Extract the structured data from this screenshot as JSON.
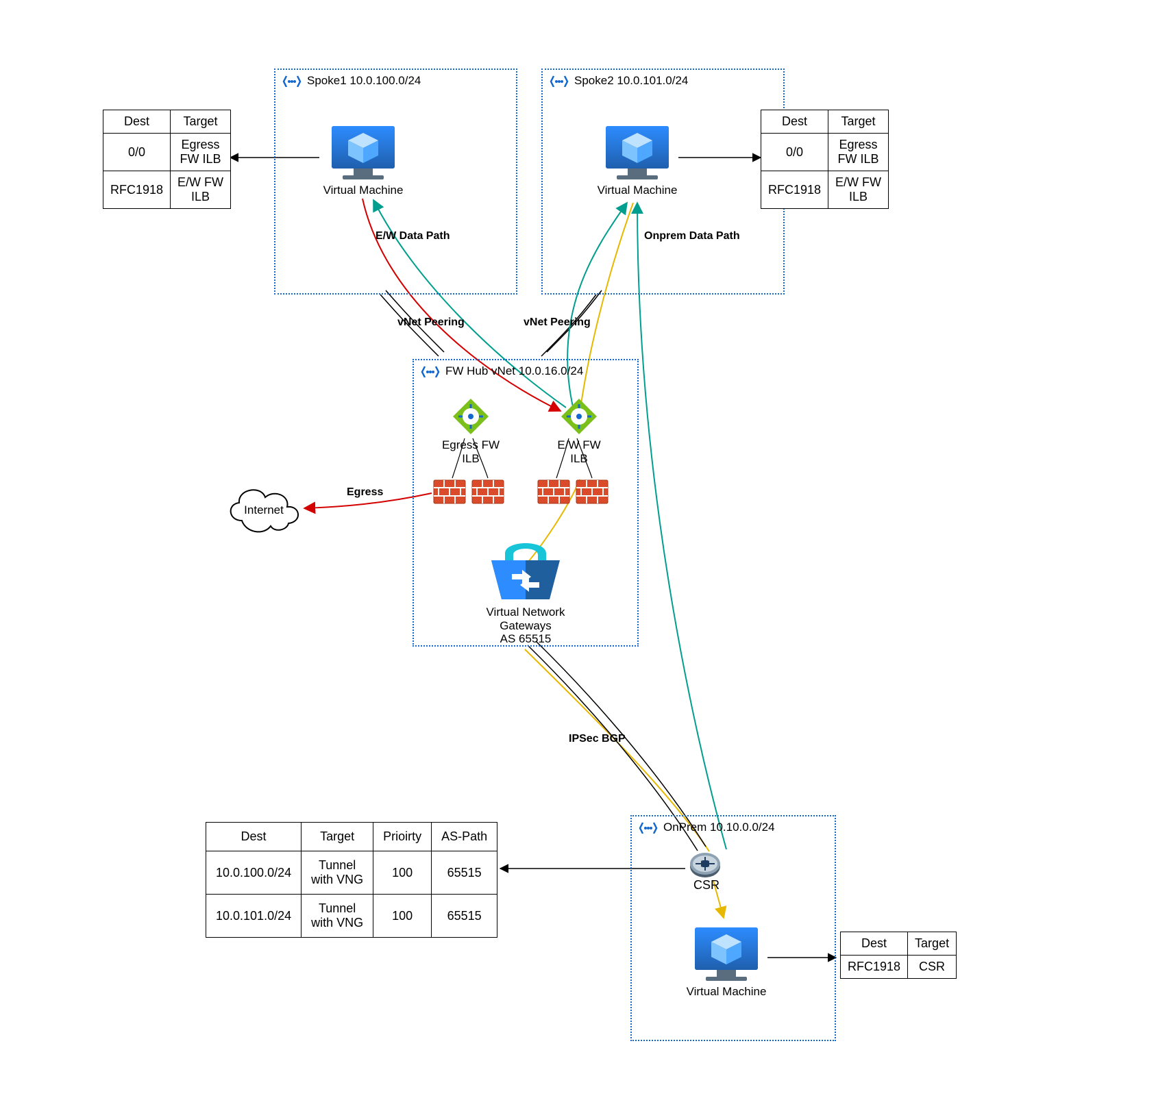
{
  "vnets": {
    "spoke1": {
      "title": "Spoke1 10.0.100.0/24"
    },
    "spoke2": {
      "title": "Spoke2 10.0.101.0/24"
    },
    "hub": {
      "title": "FW Hub vNet 10.0.16.0/24"
    },
    "onprem": {
      "title": "OnPrem 10.10.0.0/24"
    }
  },
  "nodes": {
    "vm_label": "Virtual Machine",
    "egress_ilb": "Egress FW\nILB",
    "ew_ilb": "E/W FW ILB",
    "vng": "Virtual Network\nGateways\nAS 65515",
    "csr": "CSR",
    "internet": "Internet"
  },
  "labels": {
    "ew_path": "E/W Data Path",
    "onprem_path": "Onprem Data Path",
    "vnet_peering": "vNet Peering",
    "egress": "Egress",
    "ipsec": "IPSec BGP"
  },
  "tables": {
    "spoke_rt": {
      "headers": [
        "Dest",
        "Target"
      ],
      "rows": [
        [
          "0/0",
          "Egress\nFW ILB"
        ],
        [
          "RFC1918",
          "E/W FW\nILB"
        ]
      ]
    },
    "csr_rt": {
      "headers": [
        "Dest",
        "Target",
        "Prioirty",
        "AS-Path"
      ],
      "rows": [
        [
          "10.0.100.0/24",
          "Tunnel\nwith VNG",
          "100",
          "65515"
        ],
        [
          "10.0.101.0/24",
          "Tunnel\nwith VNG",
          "100",
          "65515"
        ]
      ]
    },
    "onprem_vm_rt": {
      "headers": [
        "Dest",
        "Target"
      ],
      "rows": [
        [
          "RFC1918",
          "CSR"
        ]
      ]
    }
  },
  "chart_data": {
    "type": "diagram",
    "title": "Azure hub-spoke network with firewall inspection and on-prem VPN",
    "networks": [
      {
        "name": "Spoke1",
        "cidr": "10.0.100.0/24"
      },
      {
        "name": "Spoke2",
        "cidr": "10.0.101.0/24"
      },
      {
        "name": "FW Hub vNet",
        "cidr": "10.0.16.0/24"
      },
      {
        "name": "OnPrem",
        "cidr": "10.10.0.0/24"
      }
    ],
    "components": [
      {
        "name": "Virtual Machine",
        "network": "Spoke1"
      },
      {
        "name": "Virtual Machine",
        "network": "Spoke2"
      },
      {
        "name": "Egress FW ILB",
        "network": "FW Hub vNet"
      },
      {
        "name": "E/W FW ILB",
        "network": "FW Hub vNet"
      },
      {
        "name": "Firewall pair (egress)",
        "network": "FW Hub vNet"
      },
      {
        "name": "Firewall pair (east-west)",
        "network": "FW Hub vNet"
      },
      {
        "name": "Virtual Network Gateways",
        "network": "FW Hub vNet",
        "asn": 65515
      },
      {
        "name": "CSR",
        "network": "OnPrem"
      },
      {
        "name": "Virtual Machine",
        "network": "OnPrem"
      },
      {
        "name": "Internet",
        "network": "external"
      }
    ],
    "connections": [
      {
        "from": "Spoke1",
        "to": "FW Hub vNet",
        "type": "vNet Peering"
      },
      {
        "from": "Spoke2",
        "to": "FW Hub vNet",
        "type": "vNet Peering"
      },
      {
        "from": "Spoke1 VM",
        "to": "Spoke2 VM",
        "via": "E/W FW ILB",
        "label": "E/W Data Path"
      },
      {
        "from": "Spoke2 VM",
        "to": "OnPrem VM",
        "via": [
          "E/W FW ILB",
          "Virtual Network Gateways",
          "CSR"
        ],
        "label": "Onprem Data Path"
      },
      {
        "from": "Egress FW ILB",
        "to": "Internet",
        "label": "Egress"
      },
      {
        "from": "Virtual Network Gateways",
        "to": "CSR",
        "type": "IPSec BGP"
      }
    ],
    "route_tables": {
      "spoke_vm": [
        {
          "dest": "0/0",
          "target": "Egress FW ILB"
        },
        {
          "dest": "RFC1918",
          "target": "E/W FW ILB"
        }
      ],
      "csr": [
        {
          "dest": "10.0.100.0/24",
          "target": "Tunnel with VNG",
          "priority": 100,
          "as_path": "65515"
        },
        {
          "dest": "10.0.101.0/24",
          "target": "Tunnel with VNG",
          "priority": 100,
          "as_path": "65515"
        }
      ],
      "onprem_vm": [
        {
          "dest": "RFC1918",
          "target": "CSR"
        }
      ]
    }
  }
}
